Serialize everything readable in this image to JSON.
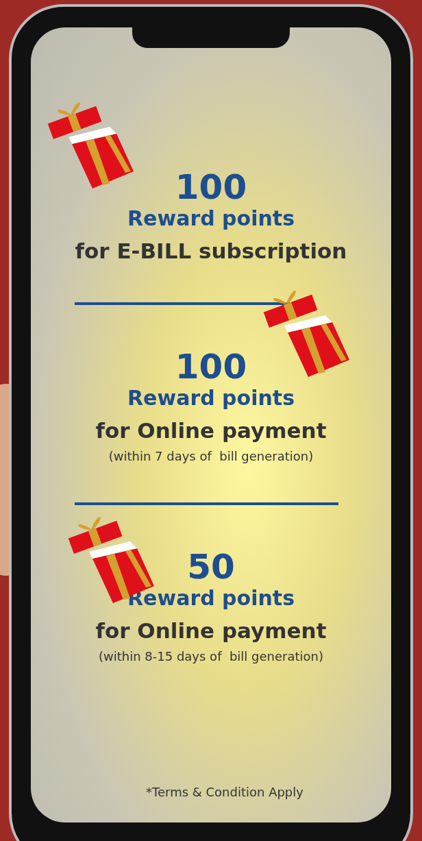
{
  "offers": [
    {
      "points": "100",
      "label": "Reward points",
      "title": "for E-BILL subscription"
    },
    {
      "points": "100",
      "label": "Reward points",
      "title": "for Online payment",
      "note": "(within 7 days of  bill generation)"
    },
    {
      "points": "50",
      "label": "Reward points",
      "title": "for Online payment",
      "note": "(within 8-15 days of  bill generation)"
    }
  ],
  "footnote": "*Terms & Condition Apply"
}
